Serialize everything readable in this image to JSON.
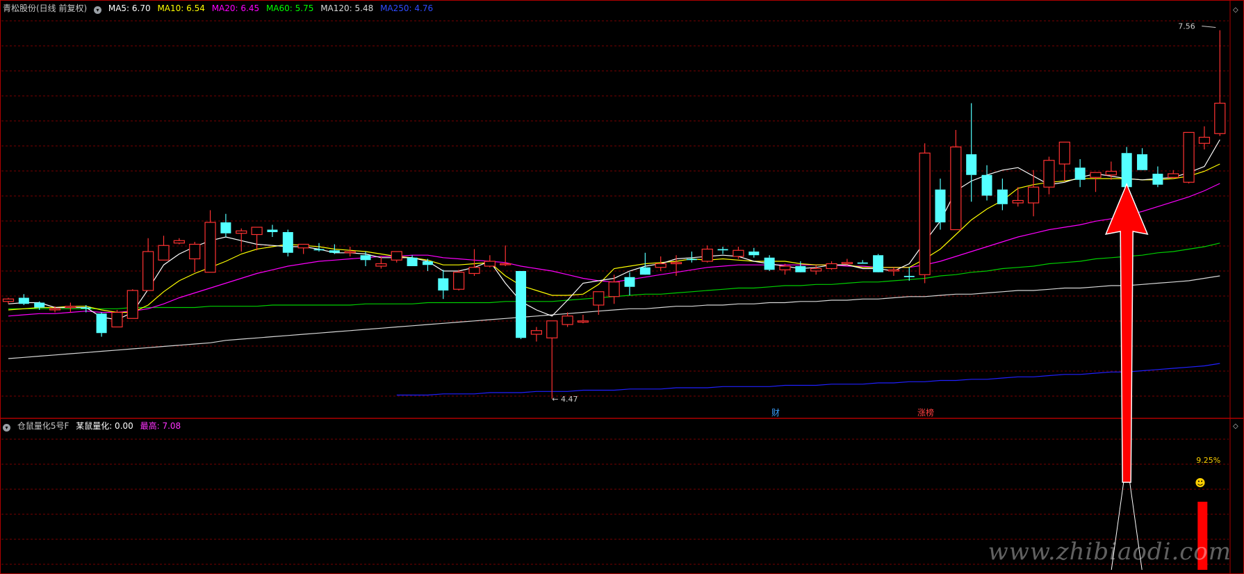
{
  "main_panel": {
    "title": "青松股份(日线 前复权)",
    "ma_legend": [
      {
        "label": "MA5: 6.70",
        "color": "#ffffff"
      },
      {
        "label": "MA10: 6.54",
        "color": "#ffff00"
      },
      {
        "label": "MA20: 6.45",
        "color": "#ff00ff"
      },
      {
        "label": "MA60: 5.75",
        "color": "#00ff00"
      },
      {
        "label": "MA120: 5.48",
        "color": "#d8d8d8"
      },
      {
        "label": "MA250: 4.76",
        "color": "#0000ff"
      }
    ],
    "high_marker": "7.56",
    "low_marker": "4.47",
    "event_markers": [
      {
        "label": "财",
        "color": "#3aa0ff"
      },
      {
        "label": "涨榜",
        "color": "#ff4040"
      }
    ]
  },
  "sub_panel": {
    "title": "仓鼠量化5号F",
    "value_label": "某鼠量化: 0.00",
    "max_label": "最高: 7.08",
    "percent_label": "9.25%",
    "smiley": "☻"
  },
  "watermark": "www.zhibiaodi.com",
  "colors": {
    "up": "#ff3232",
    "down": "#54ffff",
    "grid": "#7a0000",
    "frame": "#b00000"
  },
  "chart_data": {
    "type": "candlestick",
    "price_range": [
      4.4,
      7.6
    ],
    "candles": [
      [
        5.27,
        5.3,
        5.25,
        5.29
      ],
      [
        5.3,
        5.33,
        5.24,
        5.25
      ],
      [
        5.26,
        5.27,
        5.2,
        5.22
      ],
      [
        5.2,
        5.23,
        5.18,
        5.21
      ],
      [
        5.22,
        5.26,
        5.18,
        5.23
      ],
      [
        5.22,
        5.24,
        5.18,
        5.21
      ],
      [
        5.17,
        5.18,
        4.98,
        5.01
      ],
      [
        5.06,
        5.2,
        5.06,
        5.18
      ],
      [
        5.13,
        5.37,
        5.13,
        5.36
      ],
      [
        5.36,
        5.79,
        5.36,
        5.68
      ],
      [
        5.61,
        5.81,
        5.61,
        5.73
      ],
      [
        5.75,
        5.79,
        5.74,
        5.77
      ],
      [
        5.62,
        5.76,
        5.51,
        5.74
      ],
      [
        5.51,
        6.02,
        5.51,
        5.92
      ],
      [
        5.92,
        5.99,
        5.8,
        5.83
      ],
      [
        5.83,
        5.87,
        5.68,
        5.85
      ],
      [
        5.82,
        5.87,
        5.69,
        5.88
      ],
      [
        5.86,
        5.9,
        5.8,
        5.84
      ],
      [
        5.84,
        5.86,
        5.64,
        5.67
      ],
      [
        5.71,
        5.73,
        5.66,
        5.74
      ],
      [
        5.7,
        5.75,
        5.68,
        5.69
      ],
      [
        5.69,
        5.74,
        5.66,
        5.67
      ],
      [
        5.67,
        5.72,
        5.64,
        5.68
      ],
      [
        5.65,
        5.68,
        5.56,
        5.61
      ],
      [
        5.56,
        5.64,
        5.54,
        5.58
      ],
      [
        5.61,
        5.68,
        5.59,
        5.68
      ],
      [
        5.63,
        5.65,
        5.57,
        5.56
      ],
      [
        5.6,
        5.62,
        5.52,
        5.57
      ],
      [
        5.46,
        5.53,
        5.29,
        5.36
      ],
      [
        5.37,
        5.53,
        5.36,
        5.51
      ],
      [
        5.5,
        5.7,
        5.48,
        5.55
      ],
      [
        5.56,
        5.65,
        5.55,
        5.6
      ],
      [
        5.58,
        5.73,
        5.56,
        5.58
      ],
      [
        5.52,
        5.52,
        4.96,
        4.97
      ],
      [
        5.0,
        5.06,
        4.94,
        5.03
      ],
      [
        4.97,
        5.11,
        4.47,
        5.11
      ],
      [
        5.08,
        5.18,
        5.06,
        5.15
      ],
      [
        5.1,
        5.16,
        5.09,
        5.11
      ],
      [
        5.24,
        5.29,
        5.16,
        5.35
      ],
      [
        5.31,
        5.49,
        5.25,
        5.43
      ],
      [
        5.47,
        5.51,
        5.32,
        5.39
      ],
      [
        5.55,
        5.67,
        5.5,
        5.49
      ],
      [
        5.55,
        5.64,
        5.52,
        5.58
      ],
      [
        5.58,
        5.65,
        5.48,
        5.59
      ],
      [
        5.62,
        5.68,
        5.59,
        5.61
      ],
      [
        5.6,
        5.73,
        5.59,
        5.7
      ],
      [
        5.7,
        5.72,
        5.66,
        5.69
      ],
      [
        5.64,
        5.72,
        5.62,
        5.69
      ],
      [
        5.68,
        5.71,
        5.63,
        5.65
      ],
      [
        5.63,
        5.65,
        5.52,
        5.53
      ],
      [
        5.53,
        5.58,
        5.49,
        5.56
      ],
      [
        5.56,
        5.6,
        5.52,
        5.51
      ],
      [
        5.52,
        5.57,
        5.49,
        5.54
      ],
      [
        5.54,
        5.6,
        5.53,
        5.58
      ],
      [
        5.58,
        5.62,
        5.57,
        5.59
      ],
      [
        5.59,
        5.61,
        5.58,
        5.58
      ],
      [
        5.65,
        5.66,
        5.55,
        5.51
      ],
      [
        5.52,
        5.55,
        5.48,
        5.53
      ],
      [
        5.48,
        5.55,
        5.44,
        5.47
      ],
      [
        5.49,
        6.57,
        5.42,
        6.49
      ],
      [
        6.19,
        6.28,
        5.86,
        5.92
      ],
      [
        5.86,
        6.68,
        5.86,
        6.54
      ],
      [
        6.48,
        6.9,
        6.09,
        6.31
      ],
      [
        6.31,
        6.39,
        6.1,
        6.14
      ],
      [
        6.19,
        6.28,
        6.02,
        6.07
      ],
      [
        6.08,
        6.21,
        6.05,
        6.1
      ],
      [
        6.08,
        6.35,
        5.97,
        6.21
      ],
      [
        6.21,
        6.46,
        6.15,
        6.43
      ],
      [
        6.4,
        6.53,
        6.26,
        6.58
      ],
      [
        6.37,
        6.44,
        6.21,
        6.27
      ],
      [
        6.29,
        6.31,
        6.17,
        6.33
      ],
      [
        6.31,
        6.42,
        6.27,
        6.34
      ],
      [
        6.49,
        6.54,
        6.28,
        6.21
      ],
      [
        6.48,
        6.53,
        6.36,
        6.35
      ],
      [
        6.32,
        6.38,
        6.21,
        6.23
      ],
      [
        6.29,
        6.35,
        6.28,
        6.32
      ],
      [
        6.25,
        6.61,
        6.24,
        6.66
      ],
      [
        6.57,
        6.71,
        6.52,
        6.62
      ],
      [
        6.65,
        7.5,
        6.63,
        6.9
      ]
    ],
    "ma5": [
      5.25,
      5.26,
      5.26,
      5.22,
      5.22,
      5.22,
      5.14,
      5.12,
      5.18,
      5.37,
      5.57,
      5.66,
      5.72,
      5.77,
      5.8,
      5.77,
      5.74,
      5.73,
      5.72,
      5.72,
      5.7,
      5.67,
      5.67,
      5.66,
      5.63,
      5.63,
      5.63,
      5.6,
      5.52,
      5.52,
      5.55,
      5.6,
      5.42,
      5.27,
      5.2,
      5.15,
      5.28,
      5.42,
      5.44,
      5.46,
      5.52,
      5.56,
      5.58,
      5.62,
      5.63,
      5.64,
      5.65,
      5.64,
      5.6,
      5.58,
      5.56,
      5.54,
      5.55,
      5.57,
      5.57,
      5.54,
      5.54,
      5.52,
      5.58,
      5.76,
      5.93,
      6.18,
      6.26,
      6.31,
      6.35,
      6.37,
      6.3,
      6.23,
      6.25,
      6.29,
      6.32,
      6.3,
      6.28,
      6.27,
      6.28,
      6.29,
      6.33,
      6.38,
      6.6
    ],
    "ma10": [
      5.2,
      5.21,
      5.22,
      5.22,
      5.23,
      5.23,
      5.2,
      5.18,
      5.18,
      5.24,
      5.35,
      5.44,
      5.5,
      5.55,
      5.6,
      5.66,
      5.7,
      5.72,
      5.74,
      5.73,
      5.72,
      5.7,
      5.69,
      5.68,
      5.66,
      5.64,
      5.63,
      5.61,
      5.57,
      5.57,
      5.58,
      5.59,
      5.48,
      5.4,
      5.36,
      5.32,
      5.32,
      5.33,
      5.41,
      5.54,
      5.56,
      5.58,
      5.59,
      5.6,
      5.62,
      5.61,
      5.62,
      5.61,
      5.6,
      5.6,
      5.6,
      5.58,
      5.57,
      5.57,
      5.57,
      5.55,
      5.55,
      5.55,
      5.55,
      5.62,
      5.7,
      5.82,
      5.94,
      6.03,
      6.1,
      6.2,
      6.23,
      6.25,
      6.26,
      6.28,
      6.28,
      6.28,
      6.28,
      6.27,
      6.27,
      6.28,
      6.3,
      6.34,
      6.4
    ],
    "ma20": [
      5.15,
      5.16,
      5.17,
      5.17,
      5.18,
      5.19,
      5.18,
      5.18,
      5.19,
      5.21,
      5.25,
      5.3,
      5.34,
      5.38,
      5.42,
      5.46,
      5.5,
      5.53,
      5.56,
      5.58,
      5.6,
      5.61,
      5.62,
      5.63,
      5.64,
      5.64,
      5.65,
      5.65,
      5.63,
      5.62,
      5.61,
      5.6,
      5.59,
      5.56,
      5.54,
      5.52,
      5.49,
      5.46,
      5.44,
      5.43,
      5.45,
      5.47,
      5.49,
      5.51,
      5.53,
      5.55,
      5.56,
      5.57,
      5.57,
      5.57,
      5.57,
      5.57,
      5.57,
      5.57,
      5.56,
      5.56,
      5.55,
      5.55,
      5.55,
      5.57,
      5.6,
      5.64,
      5.68,
      5.72,
      5.76,
      5.8,
      5.83,
      5.86,
      5.88,
      5.9,
      5.93,
      5.95,
      5.98,
      6.01,
      6.05,
      6.09,
      6.13,
      6.18,
      6.24
    ],
    "ma60": [
      5.21,
      5.21,
      5.21,
      5.21,
      5.21,
      5.21,
      5.21,
      5.21,
      5.22,
      5.22,
      5.22,
      5.22,
      5.22,
      5.23,
      5.23,
      5.23,
      5.23,
      5.24,
      5.24,
      5.24,
      5.24,
      5.24,
      5.24,
      5.25,
      5.25,
      5.25,
      5.25,
      5.26,
      5.26,
      5.26,
      5.26,
      5.26,
      5.27,
      5.27,
      5.27,
      5.27,
      5.28,
      5.29,
      5.3,
      5.31,
      5.32,
      5.33,
      5.33,
      5.34,
      5.35,
      5.36,
      5.37,
      5.38,
      5.38,
      5.39,
      5.4,
      5.4,
      5.41,
      5.41,
      5.42,
      5.43,
      5.43,
      5.44,
      5.45,
      5.46,
      5.48,
      5.49,
      5.51,
      5.52,
      5.54,
      5.55,
      5.56,
      5.58,
      5.59,
      5.6,
      5.62,
      5.63,
      5.64,
      5.65,
      5.67,
      5.68,
      5.7,
      5.72,
      5.75
    ],
    "ma120": [
      4.8,
      4.81,
      4.82,
      4.83,
      4.84,
      4.85,
      4.86,
      4.87,
      4.88,
      4.89,
      4.9,
      4.91,
      4.92,
      4.93,
      4.95,
      4.96,
      4.97,
      4.98,
      4.99,
      5.0,
      5.01,
      5.02,
      5.03,
      5.04,
      5.05,
      5.06,
      5.07,
      5.08,
      5.09,
      5.1,
      5.11,
      5.12,
      5.13,
      5.14,
      5.15,
      5.16,
      5.17,
      5.18,
      5.19,
      5.2,
      5.21,
      5.21,
      5.22,
      5.23,
      5.23,
      5.24,
      5.24,
      5.25,
      5.25,
      5.26,
      5.26,
      5.27,
      5.27,
      5.28,
      5.28,
      5.29,
      5.29,
      5.3,
      5.31,
      5.31,
      5.32,
      5.33,
      5.33,
      5.34,
      5.35,
      5.36,
      5.36,
      5.37,
      5.38,
      5.38,
      5.39,
      5.4,
      5.4,
      5.41,
      5.42,
      5.43,
      5.44,
      5.46,
      5.48
    ],
    "ma250": [
      null,
      null,
      null,
      null,
      null,
      null,
      null,
      null,
      null,
      null,
      null,
      null,
      null,
      null,
      null,
      null,
      null,
      null,
      null,
      null,
      null,
      null,
      null,
      null,
      null,
      4.5,
      4.5,
      4.5,
      4.51,
      4.51,
      4.51,
      4.52,
      4.52,
      4.52,
      4.53,
      4.53,
      4.53,
      4.54,
      4.54,
      4.54,
      4.55,
      4.55,
      4.55,
      4.56,
      4.56,
      4.56,
      4.57,
      4.57,
      4.57,
      4.57,
      4.58,
      4.58,
      4.58,
      4.59,
      4.59,
      4.59,
      4.6,
      4.6,
      4.61,
      4.61,
      4.62,
      4.62,
      4.63,
      4.63,
      4.64,
      4.65,
      4.65,
      4.66,
      4.67,
      4.67,
      4.68,
      4.69,
      4.69,
      4.7,
      4.71,
      4.72,
      4.73,
      4.74,
      4.76
    ],
    "sub_indicator_bar": {
      "value": 7.08,
      "max": 7.08
    },
    "signal_arrow": {
      "from": "sub_panel",
      "to_candle_index": 72,
      "color": "#ff0000"
    }
  }
}
